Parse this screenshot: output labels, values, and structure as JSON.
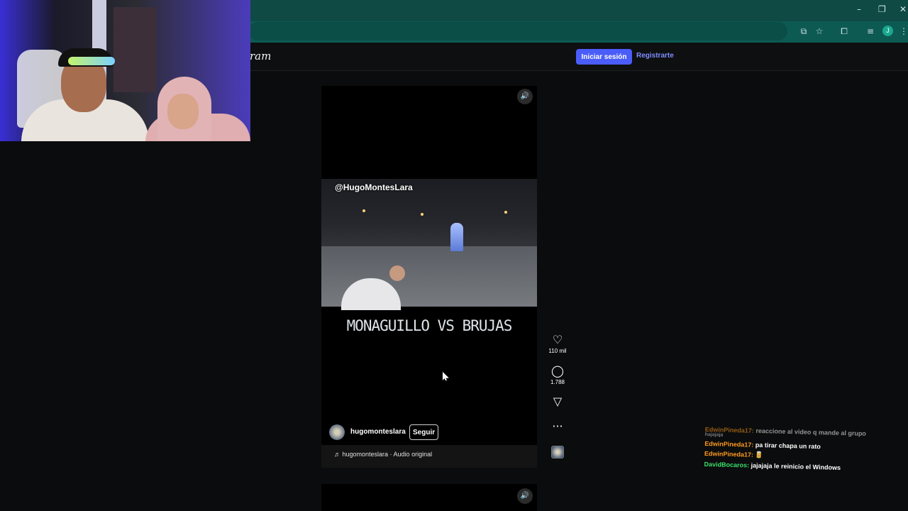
{
  "browser": {
    "window_controls": {
      "minimize": "–",
      "restore": "❐",
      "close": "✕"
    },
    "toolbar_icons": [
      "install-icon",
      "star-icon",
      "extensions-icon",
      "media-icon",
      "profile-avatar",
      "menu-icon"
    ],
    "profile_initial": "J",
    "accent": "#0d5a53"
  },
  "header": {
    "brand_partial": "ram",
    "login_label": "Iniciar sesión",
    "signup_label": "Registrarte",
    "login_color": "#4a5df9"
  },
  "reel": {
    "watermark": "@HugoMontesLara",
    "caption": "MONAGUILLO VS BRUJAS",
    "author": "hugomonteslara",
    "follow_label": "Seguir",
    "audio": "♬ hugomonteslara · Audio original",
    "likes": "110 mil",
    "comments": "1.788"
  },
  "actions": {
    "like_icon": "heart-icon",
    "comment_icon": "comment-icon",
    "share_icon": "send-icon",
    "more_icon": "more-icon",
    "more_label": "···"
  },
  "chat": [
    {
      "user": "EdwinPineda17:",
      "message": "reaccione al video q mande al grupo",
      "sub": "hajajaja",
      "user_color": "#ff9a1f",
      "dim": true
    },
    {
      "user": "EdwinPineda17:",
      "message": "pa tirar chapa un rato",
      "sub": "",
      "user_color": "#ff9a1f",
      "dim": false
    },
    {
      "user": "EdwinPineda17:",
      "message": "🥫",
      "sub": "",
      "user_color": "#ff9a1f",
      "dim": false
    },
    {
      "user": "DavidBocaros:",
      "message": "jajajaja le reinicio el Windows",
      "sub": "",
      "user_color": "#38e06a",
      "dim": false
    }
  ]
}
